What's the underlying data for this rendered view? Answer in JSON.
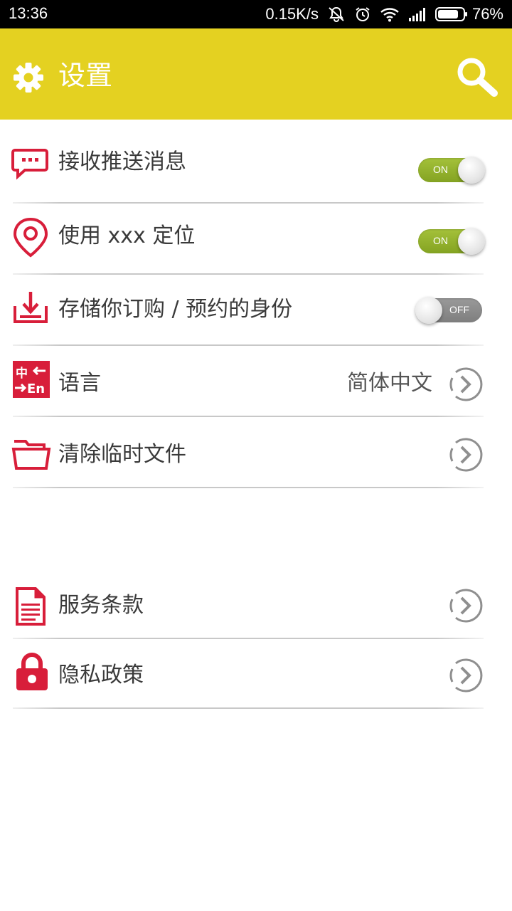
{
  "colors": {
    "accent": "#e4d121",
    "icon_red": "#d81e3a",
    "toggle_on": "#95b42e",
    "toggle_off": "#8c8c8c"
  },
  "status_bar": {
    "time": "13:36",
    "net_speed": "0.15K/s",
    "battery": "76%"
  },
  "header": {
    "title": "设置",
    "left_icon": "gear-icon",
    "right_icon": "search-icon"
  },
  "settings": [
    {
      "label": "接收推送消息",
      "icon": "message-icon",
      "toggle": "ON"
    },
    {
      "label": "使用 xxx 定位",
      "icon": "location-pin-icon",
      "toggle": "ON"
    },
    {
      "label": "存储你订购 / 预约的身份",
      "icon": "download-tray-icon",
      "toggle": "OFF"
    },
    {
      "label": "语言",
      "icon": "translate-icon",
      "value": "简体中文",
      "icon_text_top": "中",
      "icon_text_bottom": "En"
    },
    {
      "label": "清除临时文件",
      "icon": "folder-icon"
    }
  ],
  "legal": [
    {
      "label": "服务条款",
      "icon": "document-icon"
    },
    {
      "label": "隐私政策",
      "icon": "lock-icon"
    }
  ]
}
